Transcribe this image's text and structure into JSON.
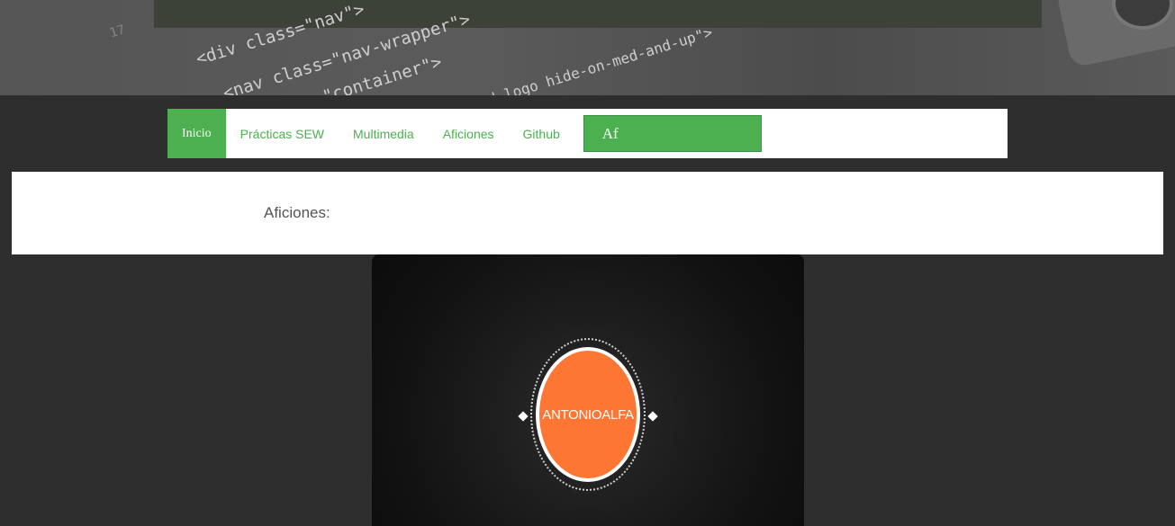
{
  "banner": {
    "code_lines": [
      "<div class=\"nav\">",
      "<nav class=\"nav-wrapper\">",
      "class=\"container\">",
      "ad-logo hide-on-med-and-up\">"
    ]
  },
  "nav": {
    "items": [
      {
        "label": "Inicio",
        "active": true
      },
      {
        "label": "Prácticas SEW",
        "active": false
      },
      {
        "label": "Multimedia",
        "active": false
      },
      {
        "label": "Aficiones",
        "active": false
      },
      {
        "label": "Github",
        "active": false
      }
    ],
    "search": {
      "value": "Af"
    }
  },
  "section": {
    "title": "Aficiones:"
  },
  "video": {
    "logo_text": "ANTONIOALFA"
  },
  "colors": {
    "accent": "#4caf50",
    "logo": "#fe7633",
    "background": "#2e2e2e"
  }
}
